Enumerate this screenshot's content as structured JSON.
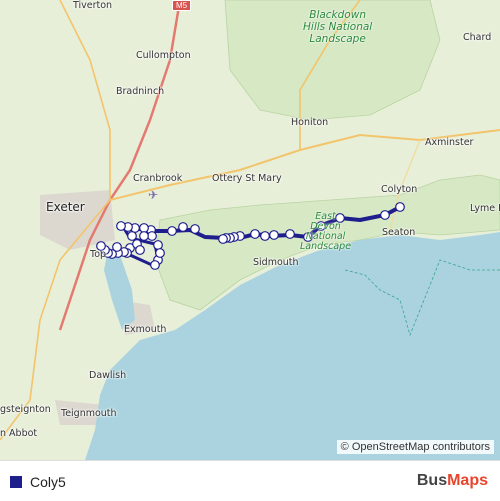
{
  "map": {
    "places": [
      {
        "name": "Tiverton"
      },
      {
        "name": "Cullompton"
      },
      {
        "name": "Bradninch"
      },
      {
        "name": "Exeter"
      },
      {
        "name": "Cranbrook"
      },
      {
        "name": "Ottery St Mary"
      },
      {
        "name": "Honiton"
      },
      {
        "name": "Chard"
      },
      {
        "name": "Axminster"
      },
      {
        "name": "Colyton"
      },
      {
        "name": "Lyme R"
      },
      {
        "name": "Seaton"
      },
      {
        "name": "Sidmouth"
      },
      {
        "name": "Exmouth"
      },
      {
        "name": "Dawlish"
      },
      {
        "name": "Teignmouth"
      },
      {
        "name": "gsteignton"
      },
      {
        "name": "n Abbot"
      },
      {
        "name": "Top"
      }
    ],
    "park_labels": {
      "blackdown": "Blackdown\nHills National\nLandscape",
      "east_devon": "East\nDevon\nNational\nLandscape"
    },
    "road_shield": "M5",
    "route_color": "#1e1e8c",
    "stop_count": 40
  },
  "attribution": "© OpenStreetMap contributors",
  "legend": {
    "route_name": "Coly5",
    "route_color": "#1e1e8c"
  },
  "brand": {
    "part1": "Bus",
    "part2": "Maps"
  }
}
